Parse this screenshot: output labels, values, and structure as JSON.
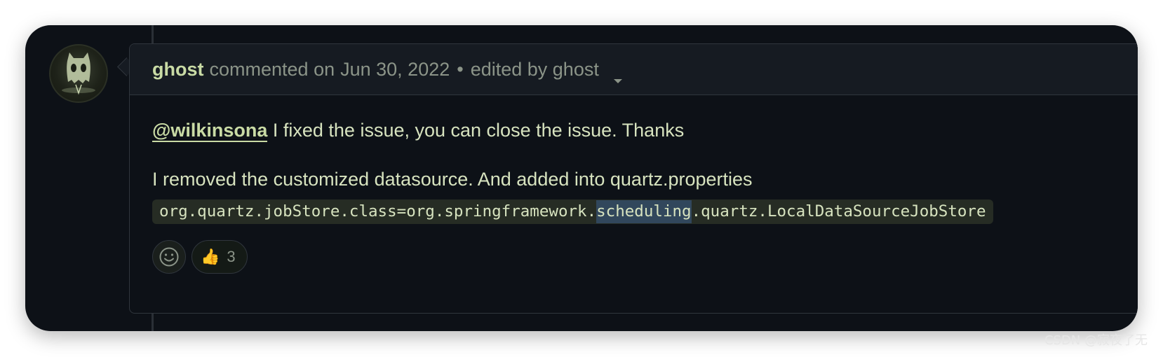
{
  "comment": {
    "author": "ghost",
    "action": "commented on",
    "date": "Jun 30, 2022",
    "separator": "•",
    "edited_by": "edited by ghost",
    "mention": "@wilkinsona",
    "line1_rest": " I fixed the issue, you can close the issue. Thanks",
    "line2": "I removed the customized datasource. And added into quartz.properties",
    "code_before": "org.quartz.jobStore.class=org.springframework.",
    "code_highlight": "scheduling",
    "code_after": ".quartz.LocalDataSourceJobStore"
  },
  "reactions": {
    "picker_icon": "smiley-icon",
    "items": [
      {
        "emoji": "👍",
        "icon": "thumbs-up-icon",
        "count": "3"
      }
    ]
  },
  "watermark": "CSDN @寂夜了无",
  "colors": {
    "background": "#0d1117",
    "header": "#161b22",
    "border": "#30363d",
    "author": "#c9dba5",
    "muted": "#8b9488",
    "text": "#d7e3bf",
    "code_bg": "#262c24",
    "highlight": "#31475c"
  }
}
